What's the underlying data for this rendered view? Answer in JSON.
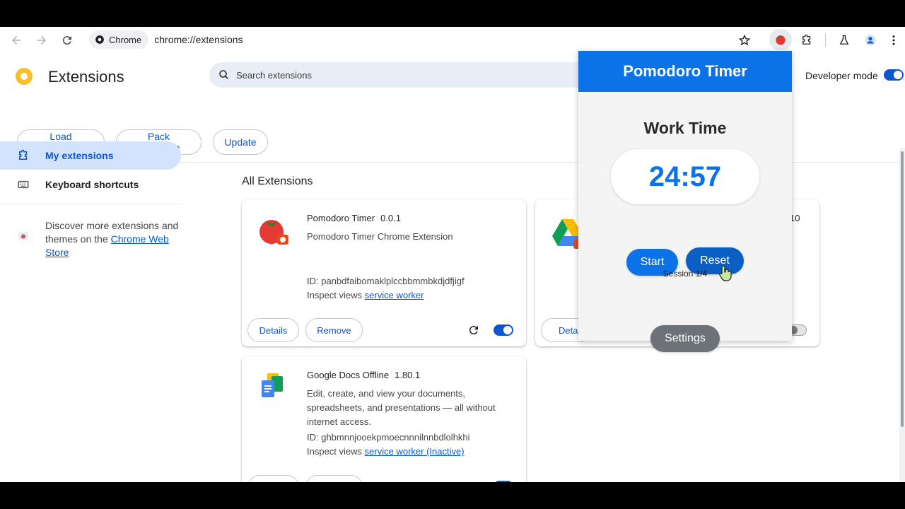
{
  "browser": {
    "chip_label": "Chrome",
    "url": "chrome://extensions"
  },
  "header": {
    "title": "Extensions",
    "search_placeholder": "Search extensions",
    "developer_mode_label": "Developer mode",
    "developer_mode_on": true,
    "buttons": {
      "load_unpacked": "Load unpacked",
      "pack_extension": "Pack extension",
      "update": "Update"
    }
  },
  "sidebar": {
    "items": [
      {
        "label": "My extensions",
        "icon": "puzzle-icon",
        "active": true
      },
      {
        "label": "Keyboard shortcuts",
        "icon": "keyboard-icon",
        "active": false
      }
    ],
    "discover_text": "Discover more extensions and themes on the ",
    "discover_link": "Chrome Web Store"
  },
  "main": {
    "section_title": "All Extensions",
    "cards": [
      {
        "name": "Pomodoro Timer",
        "version": "0.0.1",
        "description": "Pomodoro Timer Chrome Extension",
        "id_line": "ID: panbdfaibomaklplccbbmmbkdjdfjigf",
        "inspect_label": "Inspect views ",
        "inspect_link": "service worker",
        "details_label": "Details",
        "remove_label": "Remove",
        "enabled": true
      },
      {
        "name": "",
        "version_partial": "10",
        "details_label": "Detail",
        "enabled": false
      },
      {
        "name": "Google Docs Offline",
        "version": "1.80.1",
        "description": "Edit, create, and view your documents, spreadsheets, and presentations — all without internet access.",
        "id_line": "ID: ghbmnnjooekpmoecnnnilnnbdlolhkhi",
        "inspect_label": "Inspect views ",
        "inspect_link": "service worker (Inactive)",
        "enabled": true
      }
    ]
  },
  "popup": {
    "title": "Pomodoro Timer",
    "mode": "Work Time",
    "time": "24:57",
    "start_label": "Start",
    "reset_label": "Reset",
    "session": "Session 1/4",
    "settings_label": "Settings"
  },
  "colors": {
    "accent": "#0b57d0",
    "popup_blue": "#0b72e7",
    "reset_blue": "#0a5fc2",
    "settings_gray": "#6c7277"
  }
}
